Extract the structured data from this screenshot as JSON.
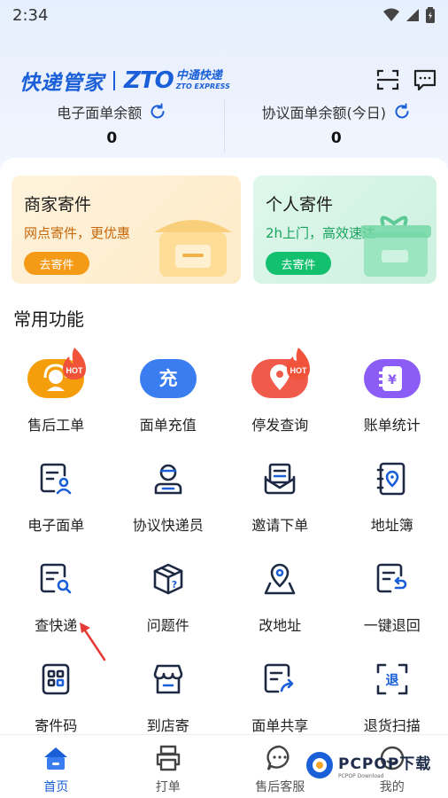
{
  "status_bar": {
    "time": "2:34"
  },
  "brand": {
    "app_name": "快递管家",
    "zto_mark": "ZTO",
    "zto_cn": "中通快递",
    "zto_en": "ZTO EXPRESS"
  },
  "balances": [
    {
      "label": "电子面单余额",
      "value": "0"
    },
    {
      "label": "协议面单余额(今日)",
      "value": "0"
    }
  ],
  "ship_cards": {
    "merchant": {
      "title": "商家寄件",
      "subtitle": "网点寄件，更优惠",
      "button": "去寄件"
    },
    "personal": {
      "title": "个人寄件",
      "subtitle": "2h上门，高效速达",
      "button": "去寄件"
    }
  },
  "section_title": "常用功能",
  "hot_badge": "HOT",
  "functions": [
    {
      "label": "售后工单",
      "icon": "headset-icon"
    },
    {
      "label": "面单充值",
      "icon": "recharge-icon",
      "glyph": "充"
    },
    {
      "label": "停发查询",
      "icon": "location-pin-icon"
    },
    {
      "label": "账单统计",
      "icon": "bill-icon"
    },
    {
      "label": "电子面单",
      "icon": "waybill-person-icon"
    },
    {
      "label": "协议快递员",
      "icon": "courier-icon"
    },
    {
      "label": "邀请下单",
      "icon": "envelope-icon"
    },
    {
      "label": "地址簿",
      "icon": "address-book-icon"
    },
    {
      "label": "查快递",
      "icon": "search-package-icon"
    },
    {
      "label": "问题件",
      "icon": "problem-box-icon"
    },
    {
      "label": "改地址",
      "icon": "change-address-icon"
    },
    {
      "label": "一键退回",
      "icon": "return-icon"
    },
    {
      "label": "寄件码",
      "icon": "qr-code-icon"
    },
    {
      "label": "到店寄",
      "icon": "store-icon"
    },
    {
      "label": "面单共享",
      "icon": "share-waybill-icon"
    },
    {
      "label": "退货扫描",
      "icon": "return-scan-icon",
      "glyph": "退"
    }
  ],
  "tabs": [
    {
      "label": "首页",
      "icon": "home-icon",
      "active": true
    },
    {
      "label": "打单",
      "icon": "printer-icon",
      "active": false
    },
    {
      "label": "售后客服",
      "icon": "chat-icon",
      "active": false
    },
    {
      "label": "我的",
      "icon": "profile-icon",
      "active": false
    }
  ],
  "watermark": {
    "main": "PCPOP下载",
    "sub": "PCPOP Download"
  },
  "colors": {
    "brand_blue": "#1a5fd8",
    "orange": "#f49a17",
    "green": "#12c06e",
    "red": "#f05a4a",
    "purple": "#8b5cf6",
    "blue": "#3a7df0"
  }
}
